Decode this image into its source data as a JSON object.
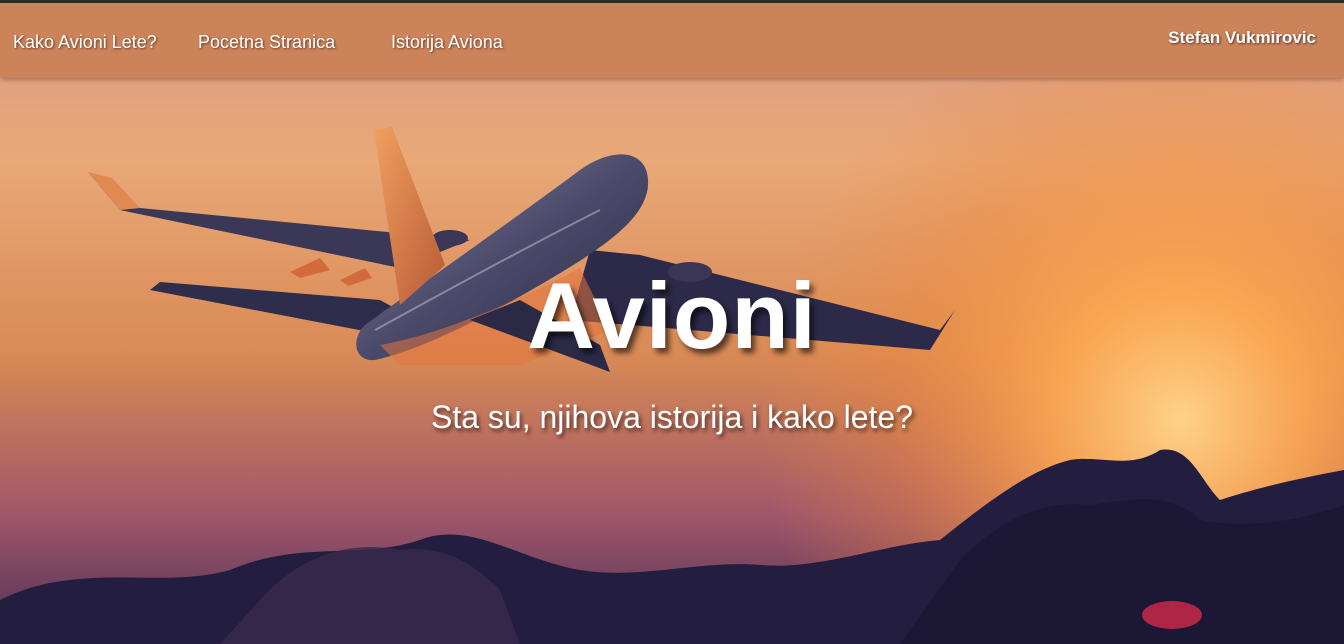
{
  "nav": {
    "links": [
      {
        "label": "Kako Avioni Lete?"
      },
      {
        "label": "Pocetna Stranica"
      },
      {
        "label": "Istorija Aviona"
      }
    ],
    "user_name": "Stefan Vukmirovic"
  },
  "hero": {
    "title": "Avioni",
    "subtitle": "Sta su, njihova istorija i kako lete?"
  },
  "colors": {
    "navbar": "#cd835a",
    "sky_top": "#e8b089",
    "sky_glow": "#f39a4a",
    "clouds": "#1f1b3a"
  }
}
